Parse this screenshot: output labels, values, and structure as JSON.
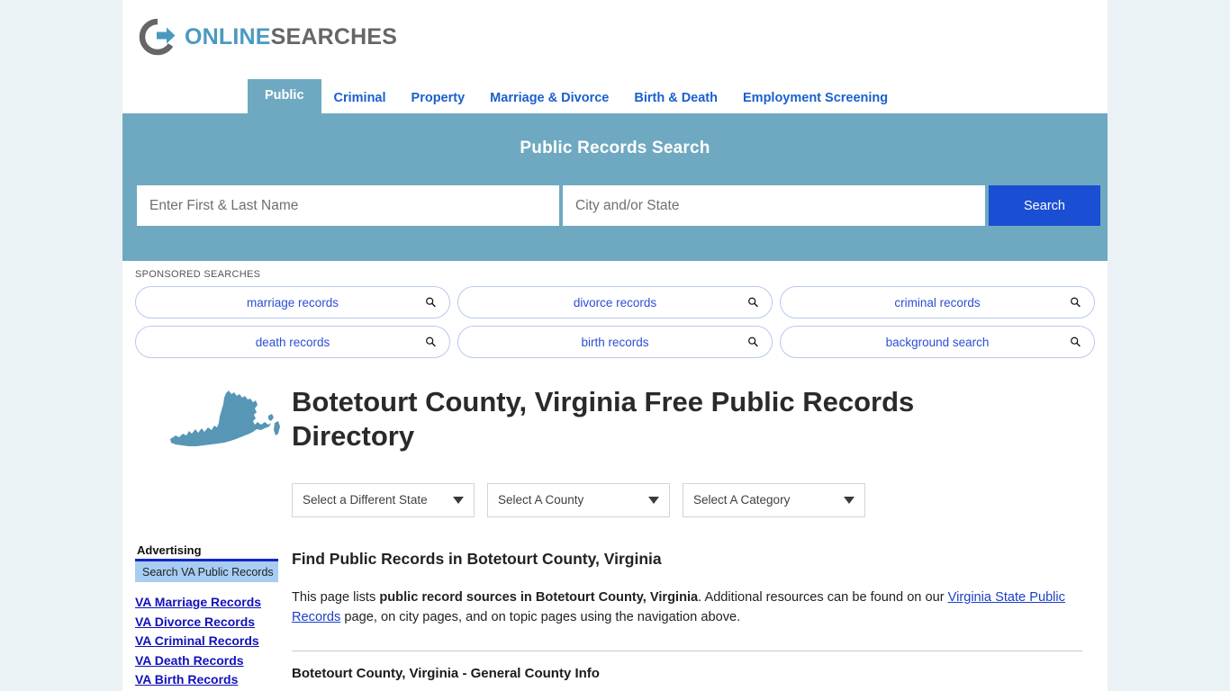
{
  "brand": {
    "logo_online": "ONLINE",
    "logo_searches": "SEARCHES"
  },
  "nav": {
    "items": [
      {
        "label": "Public",
        "active": true
      },
      {
        "label": "Criminal",
        "active": false
      },
      {
        "label": "Property",
        "active": false
      },
      {
        "label": "Marriage & Divorce",
        "active": false
      },
      {
        "label": "Birth & Death",
        "active": false
      },
      {
        "label": "Employment Screening",
        "active": false
      }
    ]
  },
  "hero": {
    "title": "Public Records Search",
    "name_placeholder": "Enter First & Last Name",
    "name_value": "",
    "location_placeholder": "City and/or State",
    "location_value": "",
    "search_button": "Search",
    "bg_color": "#6fa9c1",
    "button_color": "#1a4fd4"
  },
  "sponsored": {
    "label": "SPONSORED SEARCHES",
    "pills": [
      {
        "label": "marriage records"
      },
      {
        "label": "divorce records"
      },
      {
        "label": "criminal records"
      },
      {
        "label": "death records"
      },
      {
        "label": "birth records"
      },
      {
        "label": "background search"
      }
    ]
  },
  "main": {
    "page_title": "Botetourt County, Virginia Free Public Records Directory",
    "selects": [
      {
        "value": "Select a Different State"
      },
      {
        "value": "Select A County"
      },
      {
        "value": "Select A Category"
      }
    ],
    "section_title": "Find Public Records in Botetourt County, Virginia",
    "paragraph": {
      "lead": "This page lists ",
      "bold": "public record sources in Botetourt County, Virginia",
      "mid": ". Additional resources can be found on our ",
      "link": "Virginia State Public Records",
      "tail": " page, on city pages, and on topic pages using the navigation above."
    },
    "subsection_title": "Botetourt County, Virginia - General County Info"
  },
  "sidebar": {
    "advertising_label": "Advertising",
    "ad_box_label": "Search VA Public Records",
    "links": [
      {
        "label": "VA Marriage Records"
      },
      {
        "label": "VA Divorce Records"
      },
      {
        "label": "VA Criminal Records"
      },
      {
        "label": "VA Death Records"
      },
      {
        "label": "VA Birth Records"
      }
    ]
  },
  "colors": {
    "page_bg": "#eaf2f6",
    "teal": "#6fa9c1",
    "link_blue": "#1a5fd0",
    "ad_blue": "#1111bb"
  }
}
